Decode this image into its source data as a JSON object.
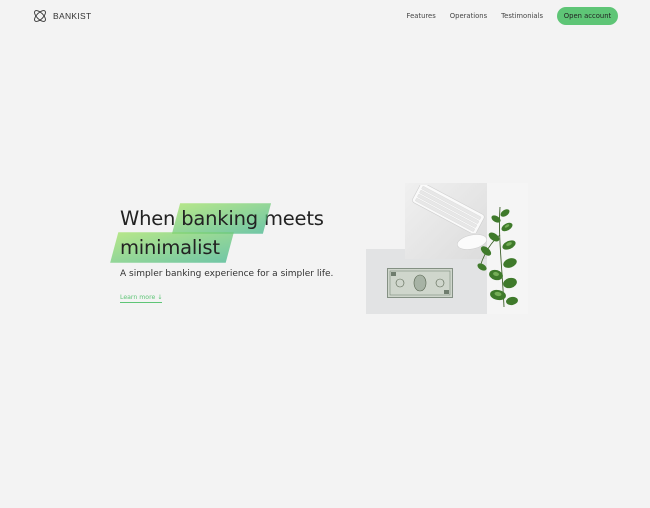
{
  "brand": {
    "name": "BANKIST",
    "logo_icon": "bankist-logo-icon"
  },
  "nav": {
    "links": [
      "Features",
      "Operations",
      "Testimonials"
    ],
    "cta_label": "Open account"
  },
  "hero": {
    "title_part1": "When",
    "title_highlight1": "banking",
    "title_part2": "meets",
    "title_highlight2": "minimalist",
    "subtitle": "A simpler banking experience for a simpler life.",
    "learn_more": "Learn more ↓"
  },
  "colors": {
    "accent": "#5ec576",
    "gradient_start": "#9be15d",
    "gradient_end": "#39b385",
    "background": "#f3f3f3"
  }
}
